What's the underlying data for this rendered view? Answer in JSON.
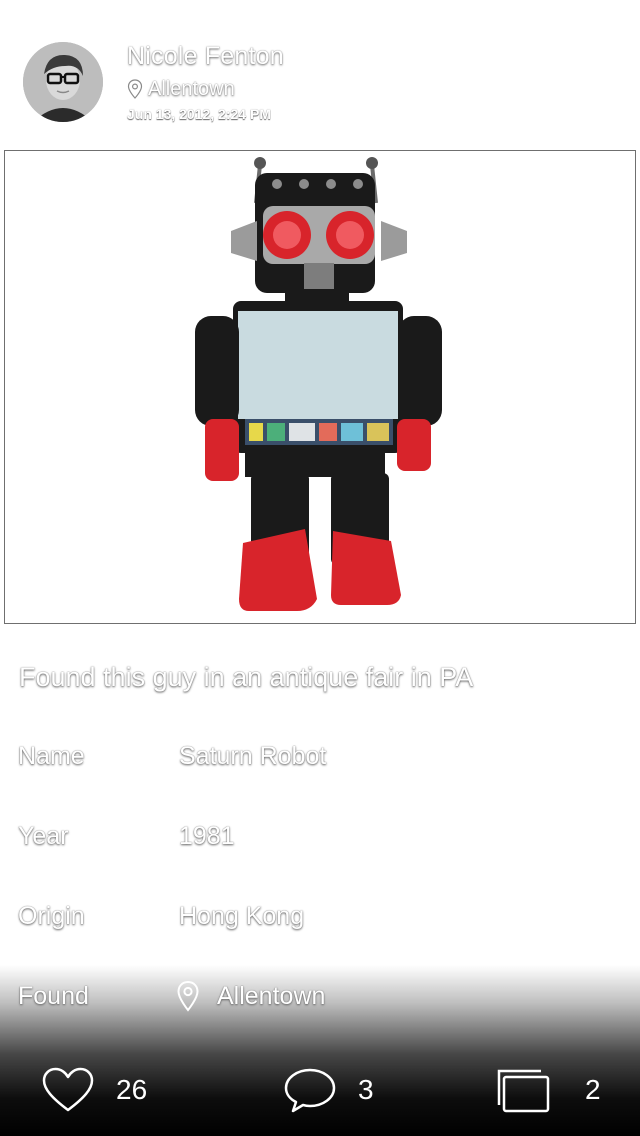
{
  "post": {
    "author": {
      "name": "Nicole Fenton",
      "location": "Allentown",
      "avatar_icon": "avatar-photo"
    },
    "timestamp": "Jun 13, 2012, 2:24 PM",
    "image_icon": "robot-photo",
    "caption": "Found this guy in an antique fair in PA"
  },
  "details": {
    "name_label": "Name",
    "name_value": "Saturn Robot",
    "year_label": "Year",
    "year_value": "1981",
    "origin_label": "Origin",
    "origin_value": "Hong Kong",
    "found_label": "Found",
    "found_value": "Allentown",
    "found_icon": "location-pin-icon"
  },
  "actions": {
    "likes": "26",
    "comments": "3",
    "collections": "2",
    "like_icon": "heart-icon",
    "comment_icon": "speech-bubble-icon",
    "collection_icon": "stacked-squares-icon"
  },
  "colors": {
    "robot_red": "#d8242b",
    "robot_black": "#1a1a1a",
    "robot_panel": "#c9dbe0",
    "bar_background": "#000000"
  }
}
